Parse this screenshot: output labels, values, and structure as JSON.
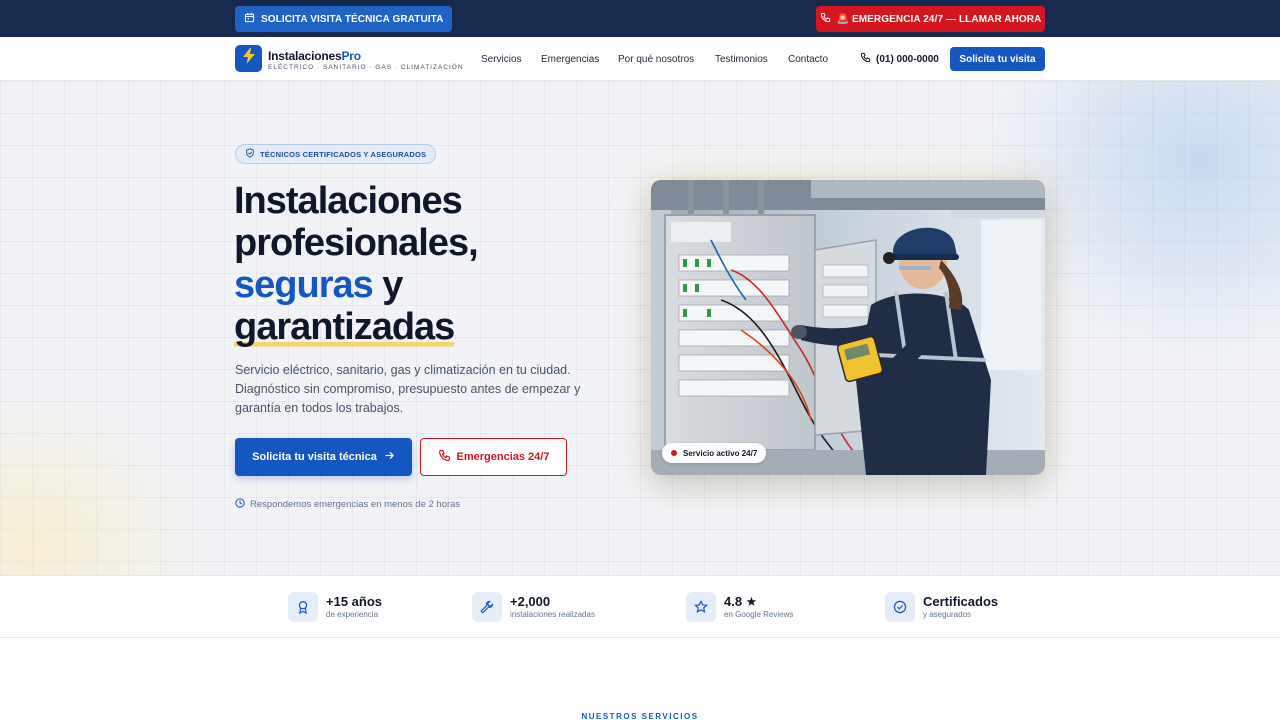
{
  "topbar": {
    "visit_label": "SOLICITA VISITA TÉCNICA GRATUITA",
    "emergency_label": "🚨 EMERGENCIA 24/7 — LLAMAR AHORA"
  },
  "brand": {
    "name_main": "Instalaciones",
    "name_accent": "Pro",
    "tagline": "ELÉCTRICO · SANITARIO · GAS · CLIMATIZACIÓN",
    "logo_icon": "lightning-bolt-icon"
  },
  "nav": {
    "links": [
      "Servicios",
      "Emergencias",
      "Por qué nosotros",
      "Testimonios",
      "Contacto"
    ],
    "phone": "(01) 000-0000",
    "cta": "Solicita tu visita"
  },
  "hero": {
    "badge": "TÉCNICOS CERTIFICADOS Y ASEGURADOS",
    "title_line1": "Instalaciones",
    "title_line2": "profesionales,",
    "title_blue": "seguras",
    "title_y": " y",
    "title_line4": "garantizadas",
    "lead": "Servicio eléctrico, sanitario, gas y climatización en tu ciudad. Diagnóstico sin compromiso, presupuesto antes de empezar y garantía en todos los trabajos.",
    "primary_cta": "Solicita tu visita técnica",
    "secondary_cta": "Emergencias 24/7",
    "note": "Respondemos emergencias en menos de 2 horas",
    "photo_tag": "Servicio activo 24/7"
  },
  "stats": [
    {
      "value": "+15 años",
      "label": "de experiencia",
      "icon": "award-icon"
    },
    {
      "value": "+2,000",
      "label": "instalaciones realizadas",
      "icon": "wrench-icon"
    },
    {
      "value": "4.8 ★",
      "label": "en Google Reviews",
      "icon": "star-icon"
    },
    {
      "value": "Certificados",
      "label": "y asegurados",
      "icon": "check-circle-icon"
    }
  ],
  "next_section": {
    "kicker": "NUESTROS SERVICIOS"
  },
  "colors": {
    "primary": "#1557c0",
    "emergency": "#d6161f",
    "topbar": "#172a4d",
    "highlight": "#f4d46b"
  }
}
